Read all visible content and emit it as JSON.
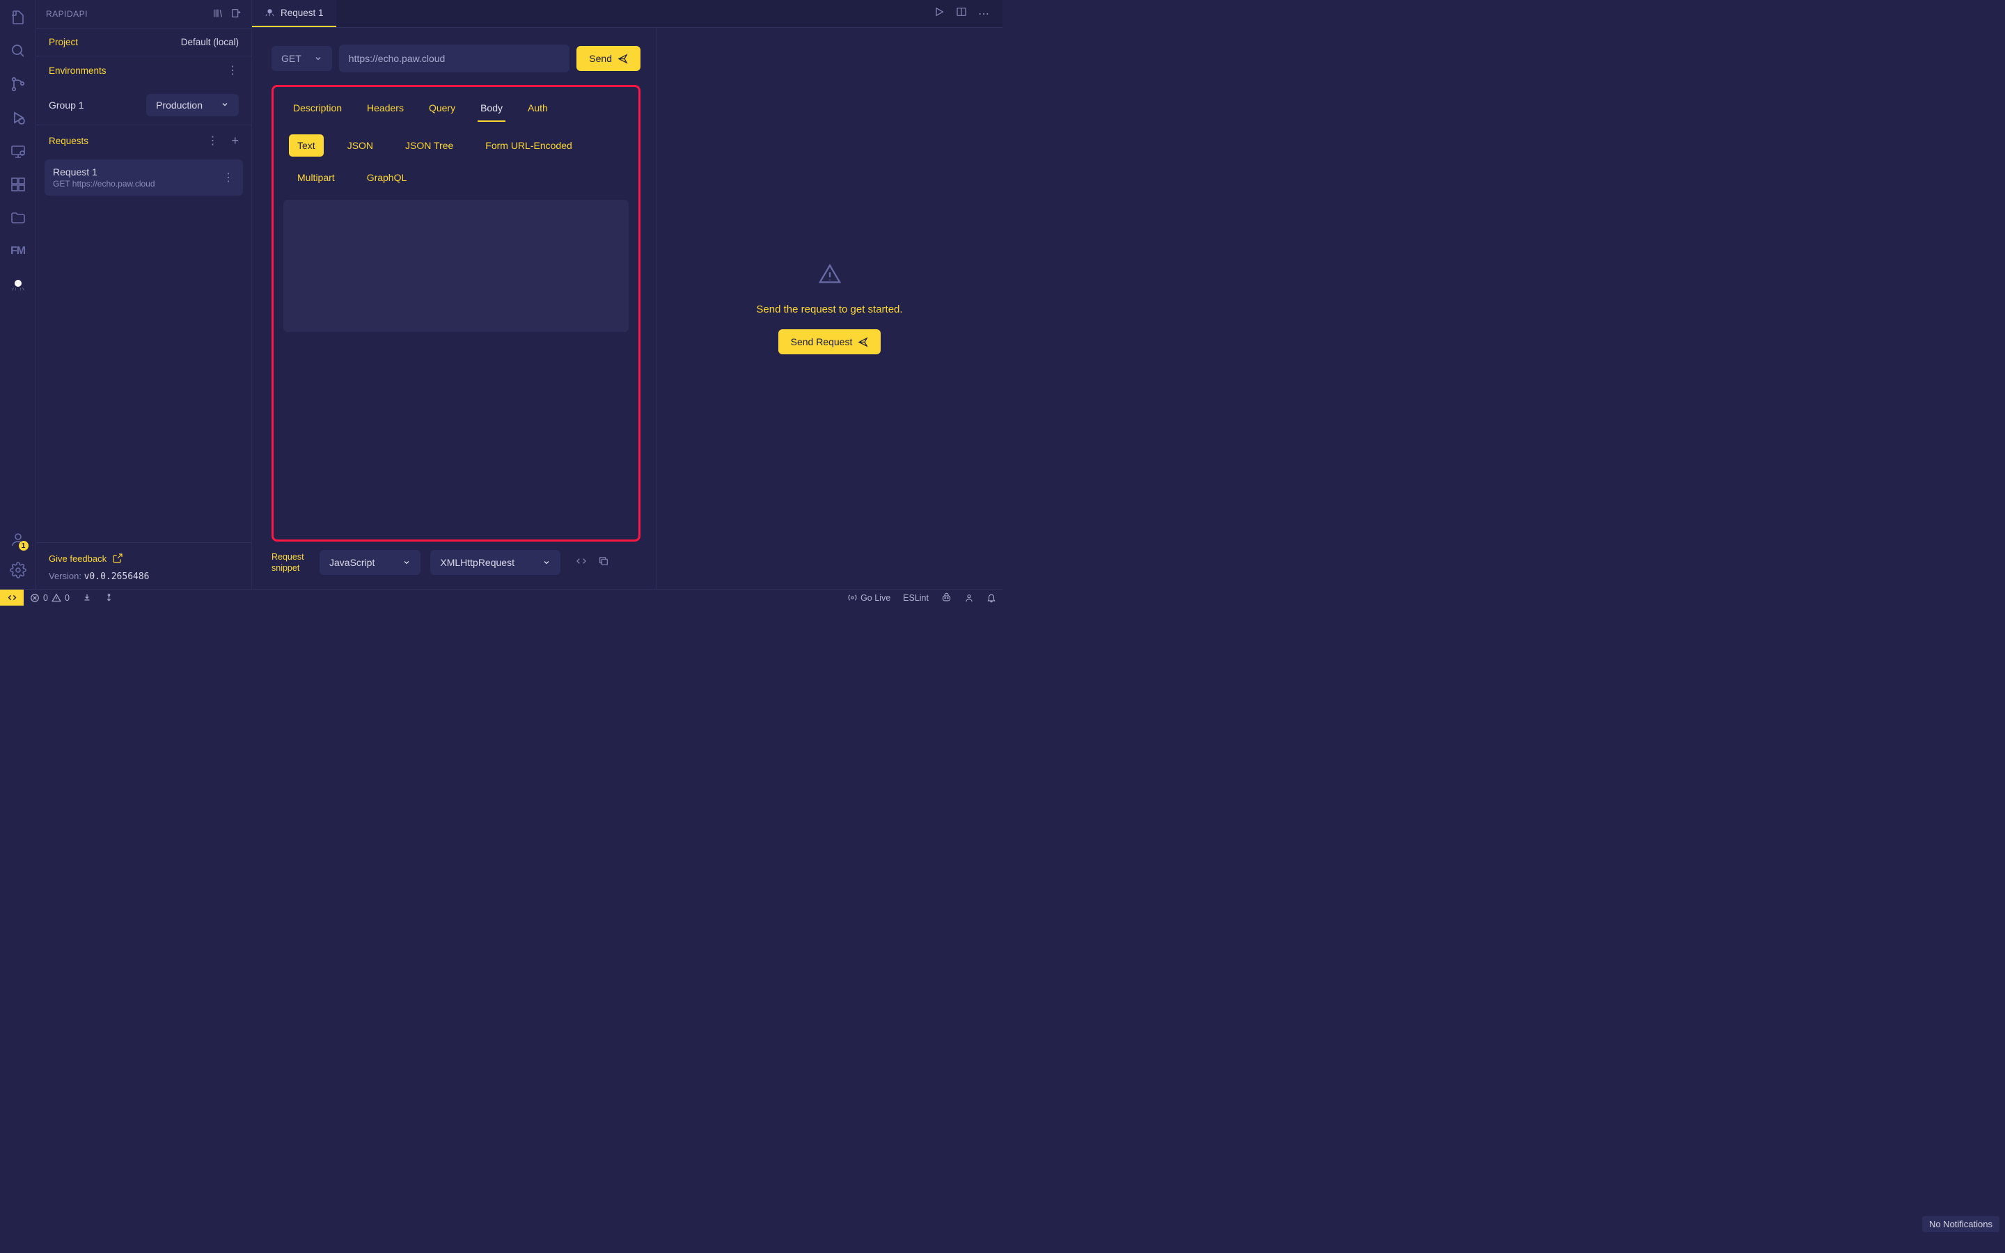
{
  "sidePanel": {
    "title": "RAPIDAPI",
    "projectLabel": "Project",
    "projectValue": "Default (local)",
    "environmentsLabel": "Environments",
    "groupName": "Group 1",
    "envSelected": "Production",
    "requestsLabel": "Requests",
    "requestItem": {
      "name": "Request 1",
      "sub": "GET https://echo.paw.cloud"
    },
    "feedback": "Give feedback",
    "versionLabel": "Version: ",
    "versionValue": "v0.0.2656486"
  },
  "accountBadge": "1",
  "tab": {
    "title": "Request 1"
  },
  "request": {
    "method": "GET",
    "url": "https://echo.paw.cloud",
    "sendLabel": "Send",
    "tabs": [
      "Description",
      "Headers",
      "Query",
      "Body",
      "Auth"
    ],
    "activeTab": "Body",
    "bodyTypes": [
      "Text",
      "JSON",
      "JSON Tree",
      "Form URL-Encoded",
      "Multipart",
      "GraphQL"
    ],
    "activeBodyType": "Text"
  },
  "snippet": {
    "label": "Request snippet",
    "lang": "JavaScript",
    "lib": "XMLHttpRequest"
  },
  "emptyState": {
    "text": "Send the request to get started.",
    "button": "Send Request"
  },
  "statusBar": {
    "errors": "0",
    "warnings": "0",
    "goLive": "Go Live",
    "eslint": "ESLint",
    "noNotifications": "No Notifications"
  }
}
